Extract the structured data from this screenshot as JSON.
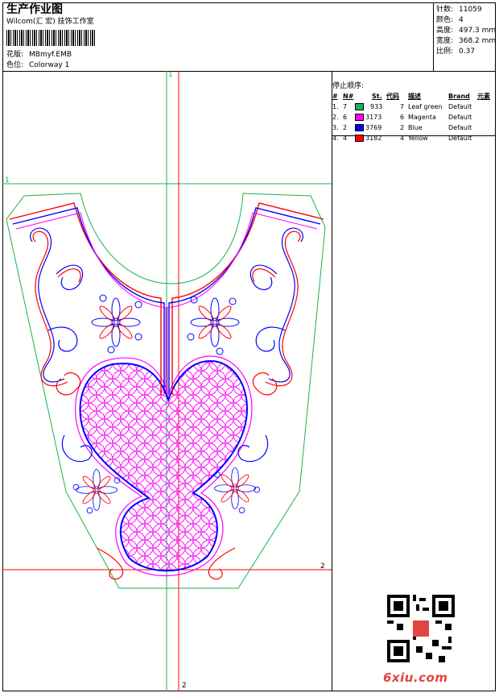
{
  "header": {
    "title": "生产作业图",
    "company": "Wilcom(汇 宏) 技饰工作室",
    "design_label": "花版:",
    "design_value": "MBmyf.EMB",
    "color_label": "色位:",
    "color_value": "Colorway 1"
  },
  "stats": [
    {
      "label": "针数:",
      "value": "11059"
    },
    {
      "label": "颜色:",
      "value": "4"
    },
    {
      "label": "高度:",
      "value": "497.3 mm"
    },
    {
      "label": "宽度:",
      "value": "368.2 mm"
    },
    {
      "label": "比例:",
      "value": "0.37"
    }
  ],
  "threads": {
    "heading": "停止顺序:",
    "columns": [
      "#",
      "N#",
      "St.",
      "代码",
      "描述",
      "Brand",
      "元素"
    ],
    "rows": [
      {
        "idx": "1.",
        "n": "7",
        "color": "#1fb35a",
        "st": "933",
        "code": "7",
        "desc": "Leaf green",
        "brand": "Default"
      },
      {
        "idx": "2.",
        "n": "6",
        "color": "#ff00ff",
        "st": "3173",
        "code": "6",
        "desc": "Magenta",
        "brand": "Default"
      },
      {
        "idx": "3.",
        "n": "2",
        "color": "#0000ff",
        "st": "3769",
        "code": "2",
        "desc": "Blue",
        "brand": "Default"
      },
      {
        "idx": "4.",
        "n": "4",
        "color": "#ff0000",
        "st": "3182",
        "code": "4",
        "desc": "Yellow",
        "brand": "Default"
      }
    ]
  },
  "guides": {
    "v1_label": "1",
    "h1_label": "1",
    "v2_label": "2",
    "h2_label": "2"
  },
  "colors": {
    "green": "#19b34b",
    "red": "#ff0000",
    "blue": "#0000ff",
    "magenta": "#ff00ff",
    "watermark": "#e0463d"
  },
  "watermark": "6xiu.com",
  "icons": {
    "qr": "qr-code-icon"
  }
}
